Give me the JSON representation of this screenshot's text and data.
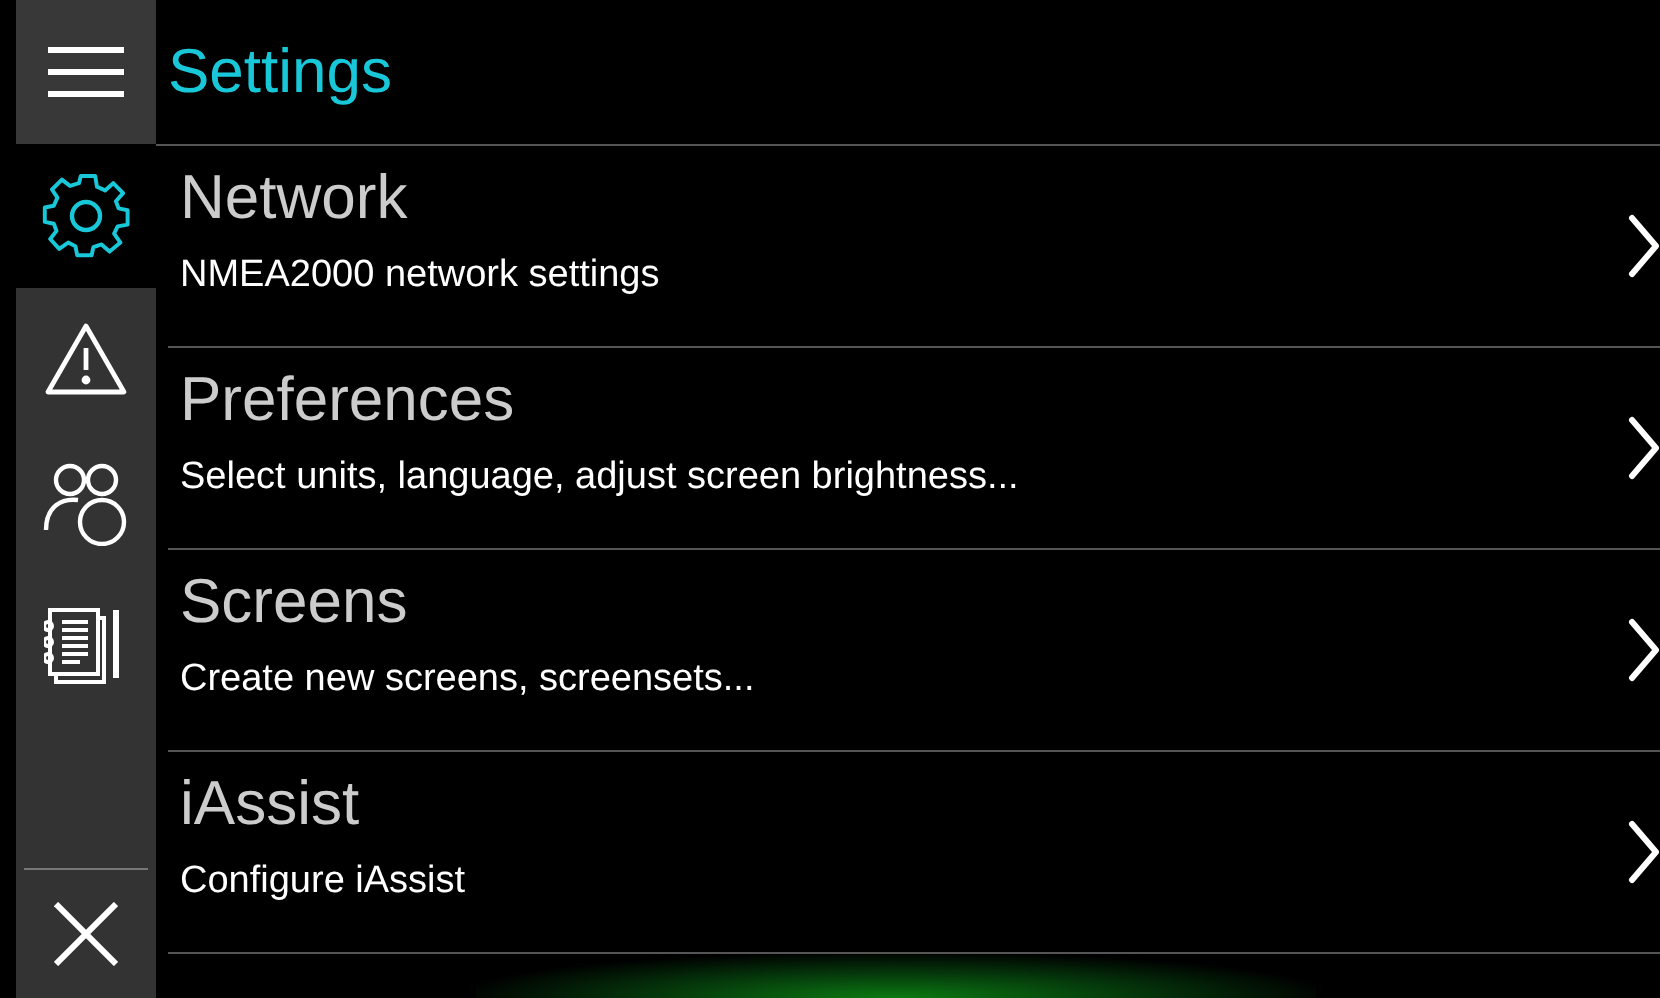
{
  "header": {
    "title": "Settings"
  },
  "sidebar": {
    "items": [
      {
        "kind": "settings",
        "selected": true
      },
      {
        "kind": "alerts",
        "selected": false
      },
      {
        "kind": "people",
        "selected": false
      },
      {
        "kind": "notes",
        "selected": false
      }
    ]
  },
  "settings": [
    {
      "title": "Network",
      "subtitle": "NMEA2000 network settings"
    },
    {
      "title": "Preferences",
      "subtitle": "Select units, language, adjust screen brightness..."
    },
    {
      "title": "Screens",
      "subtitle": "Create new screens, screensets..."
    },
    {
      "title": "iAssist",
      "subtitle": "Configure iAssist"
    }
  ]
}
